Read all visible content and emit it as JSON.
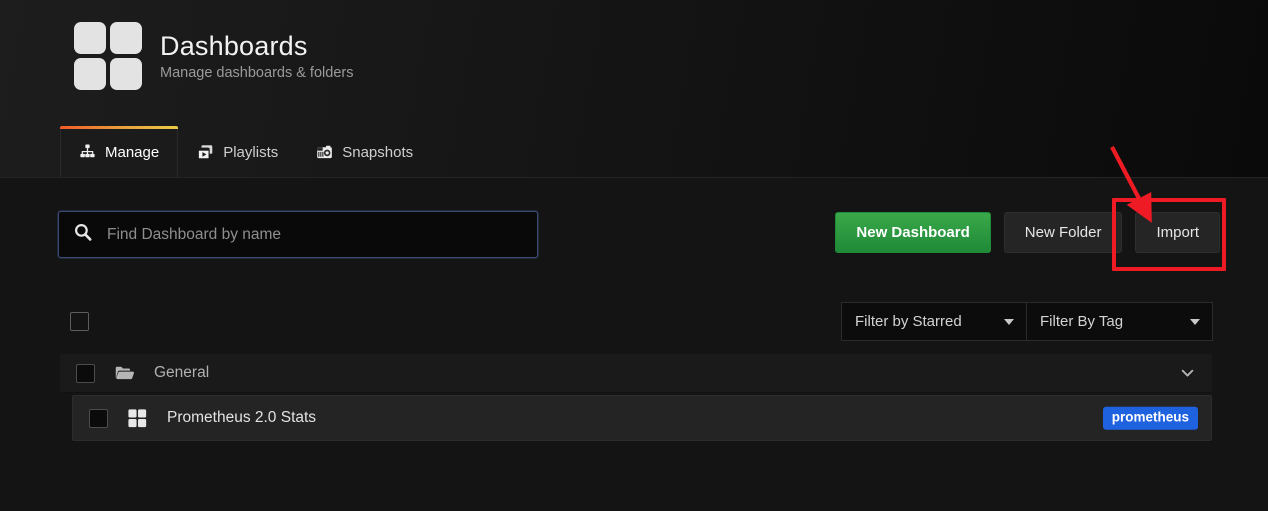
{
  "header": {
    "title": "Dashboards",
    "subtitle": "Manage dashboards & folders",
    "logo_icon": "dashboard-grid-icon"
  },
  "tabs": [
    {
      "label": "Manage",
      "icon": "sitemap-icon",
      "active": true
    },
    {
      "label": "Playlists",
      "icon": "clone-window-icon",
      "active": false
    },
    {
      "label": "Snapshots",
      "icon": "camera-retro-icon",
      "active": false
    }
  ],
  "search": {
    "placeholder": "Find Dashboard by name",
    "value": "",
    "icon": "search-icon"
  },
  "actions": {
    "new_dashboard": "New Dashboard",
    "new_folder": "New Folder",
    "import": "Import"
  },
  "filters": {
    "starred": "Filter by Starred",
    "tag": "Filter By Tag",
    "caret_icon": "caret-down-icon"
  },
  "list": {
    "select_all_checked": false,
    "folder": {
      "name": "General",
      "icon": "folder-open-icon",
      "collapse_icon": "chevron-down-icon",
      "checked": false
    },
    "dashboards": [
      {
        "name": "Prometheus 2.0 Stats",
        "icon": "dashboard-grid-icon",
        "checked": false,
        "tags": [
          "prometheus"
        ]
      }
    ]
  },
  "annotation": {
    "shape": "red-highlight-rectangle",
    "arrow": "red-arrow",
    "target": "Import",
    "color": "#ef1b24"
  },
  "colors": {
    "accent_tab": "#f05a28",
    "primary_button": "#1f8a37",
    "tag_badge": "#1f62e0",
    "page_background": "#141414"
  }
}
